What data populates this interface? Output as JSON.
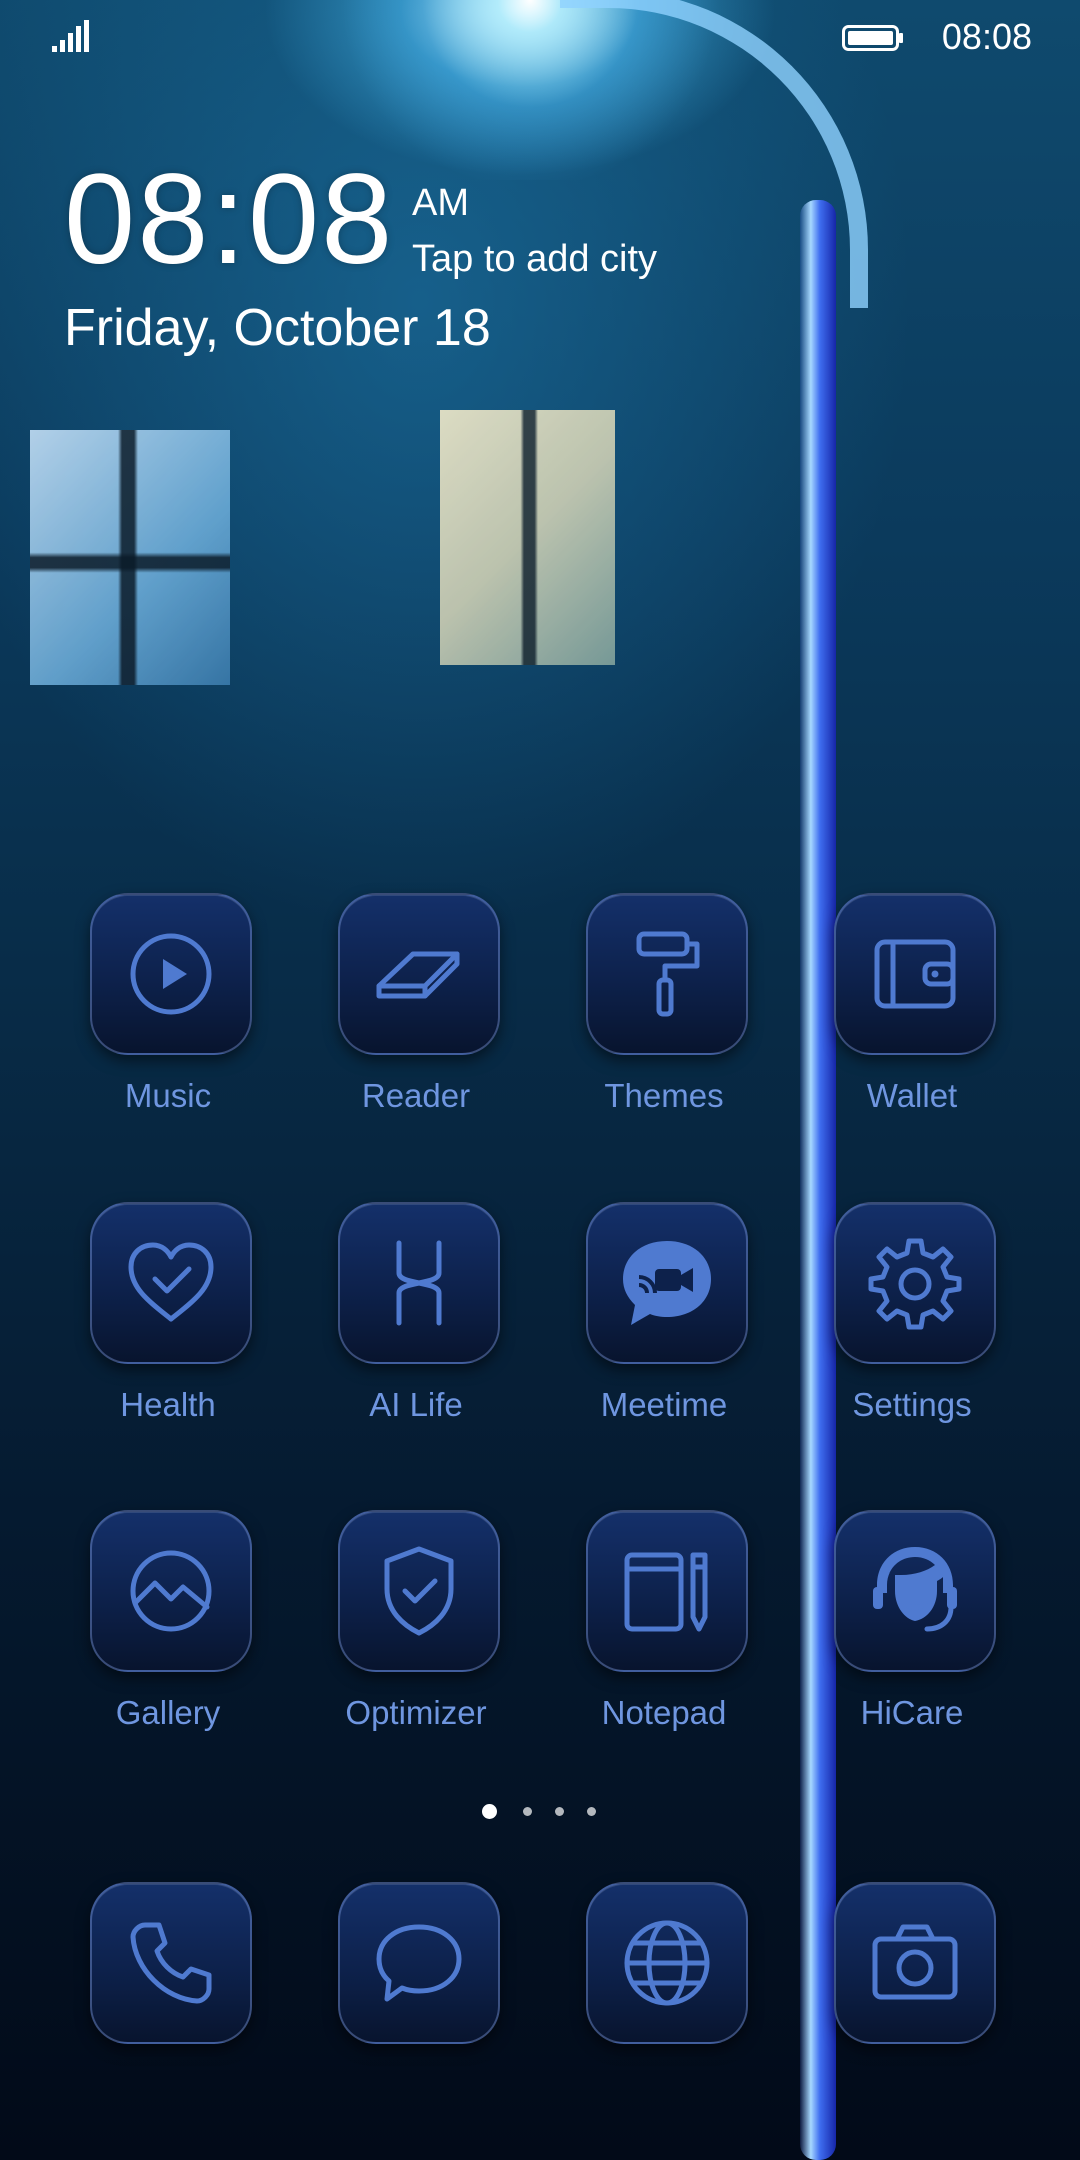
{
  "status_bar": {
    "signal_icon": "signal-bars-icon",
    "battery_icon": "battery-full-icon",
    "time": "08:08"
  },
  "clock_widget": {
    "time": "08:08",
    "am_pm": "AM",
    "city_prompt": "Tap to add city",
    "date": "Friday, October 18"
  },
  "apps": [
    {
      "label": "Music",
      "icon": "play-icon"
    },
    {
      "label": "Reader",
      "icon": "book-icon"
    },
    {
      "label": "Themes",
      "icon": "paint-roller-icon"
    },
    {
      "label": "Wallet",
      "icon": "wallet-icon"
    },
    {
      "label": "Health",
      "icon": "heart-check-icon"
    },
    {
      "label": "AI Life",
      "icon": "ai-life-icon"
    },
    {
      "label": "Meetime",
      "icon": "video-chat-icon"
    },
    {
      "label": "Settings",
      "icon": "gear-icon"
    },
    {
      "label": "Gallery",
      "icon": "gallery-icon"
    },
    {
      "label": "Optimizer",
      "icon": "shield-check-icon"
    },
    {
      "label": "Notepad",
      "icon": "notepad-icon"
    },
    {
      "label": "HiCare",
      "icon": "headset-icon"
    }
  ],
  "page_indicator": {
    "pages": 4,
    "active": 1
  },
  "dock": [
    {
      "icon": "phone-icon"
    },
    {
      "icon": "message-icon"
    },
    {
      "icon": "globe-icon"
    },
    {
      "icon": "camera-icon"
    }
  ],
  "colors": {
    "icon_stroke": "#4f7ad0",
    "label": "#6f96e0",
    "icon_tile": "#0d214b"
  }
}
